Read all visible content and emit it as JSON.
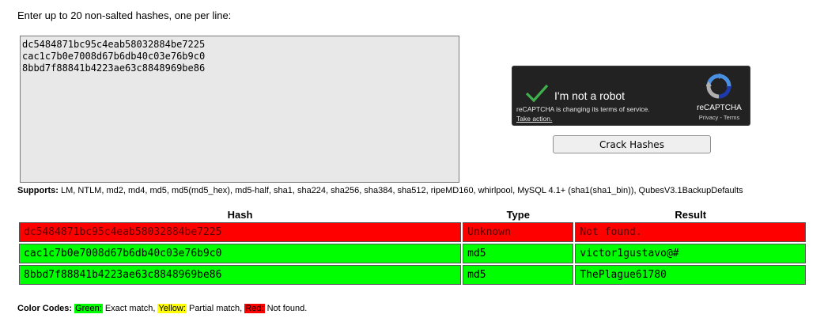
{
  "instructions": "Enter up to 20 non-salted hashes, one per line:",
  "hash_input": {
    "value": "dc5484871bc95c4eab58032884be7225\ncac1c7b0e7008d67b6db40c03e76b9c0\n8bbd7f88841b4223ae63c8848969be86"
  },
  "recaptcha": {
    "label": "I'm not a robot",
    "notice": "reCAPTCHA is changing its terms of service.",
    "take_action": "Take action.",
    "brand": "reCAPTCHA",
    "privacy": "Privacy",
    "separator": " - ",
    "terms": "Terms",
    "checked": true,
    "check_color": "#3fb04b"
  },
  "crack_button": "Crack Hashes",
  "supports": {
    "label": "Supports:",
    "text": " LM, NTLM, md2, md4, md5, md5(md5_hex), md5-half, sha1, sha224, sha256, sha384, sha512, ripeMD160, whirlpool, MySQL 4.1+ (sha1(sha1_bin)), QubesV3.1BackupDefaults"
  },
  "results": {
    "headers": [
      "Hash",
      "Type",
      "Result"
    ],
    "rows": [
      {
        "hash": "dc5484871bc95c4eab58032884be7225",
        "type": "Unknown",
        "result": "Not found.",
        "status": "red"
      },
      {
        "hash": "cac1c7b0e7008d67b6db40c03e76b9c0",
        "type": "md5",
        "result": "victor1gustavo@#",
        "status": "green"
      },
      {
        "hash": "8bbd7f88841b4223ae63c8848969be86",
        "type": "md5",
        "result": "ThePlague61780",
        "status": "green"
      }
    ]
  },
  "legend": {
    "label": "Color Codes:",
    "green_word": "Green:",
    "green_text": " Exact match, ",
    "yellow_word": "Yellow:",
    "yellow_text": " Partial match, ",
    "red_word": "Red:",
    "red_text": " Not found.",
    "colors": {
      "green": "#00ff00",
      "yellow": "#ffff00",
      "red": "#ff0000"
    }
  }
}
